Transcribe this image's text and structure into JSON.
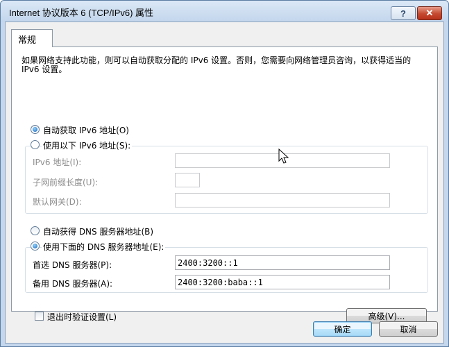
{
  "window": {
    "title": "Internet 协议版本 6 (TCP/IPv6) 属性",
    "help_label": "?",
    "close_label": "✕"
  },
  "tab": {
    "label": "常规"
  },
  "intro_text": "如果网络支持此功能，则可以自动获取分配的 IPv6 设置。否则，您需要向网络管理员咨询，以获得适当的 IPv6 设置。",
  "ipv6": {
    "auto_label": "自动获取 IPv6 地址(O)",
    "auto_checked": true,
    "manual_label": "使用以下 IPv6 地址(S):",
    "manual_checked": false,
    "address_label": "IPv6 地址(I):",
    "address_value": "",
    "prefix_label": "子网前缀长度(U):",
    "prefix_value": "",
    "gateway_label": "默认网关(D):",
    "gateway_value": ""
  },
  "dns": {
    "auto_label": "自动获得 DNS 服务器地址(B)",
    "auto_checked": false,
    "manual_label": "使用下面的 DNS 服务器地址(E):",
    "manual_checked": true,
    "preferred_label": "首选 DNS 服务器(P):",
    "preferred_value": "2400:3200::1",
    "alternate_label": "备用 DNS 服务器(A):",
    "alternate_value": "2400:3200:baba::1"
  },
  "validate": {
    "label": "退出时验证设置(L)",
    "checked": false
  },
  "buttons": {
    "advanced": "高级(V)...",
    "ok": "确定",
    "cancel": "取消"
  },
  "colors": {
    "title_bar": "#c4d7ec",
    "close_button": "#c44a30",
    "panel_bg": "#ffffff",
    "dialog_bg": "#f0f0f0"
  }
}
